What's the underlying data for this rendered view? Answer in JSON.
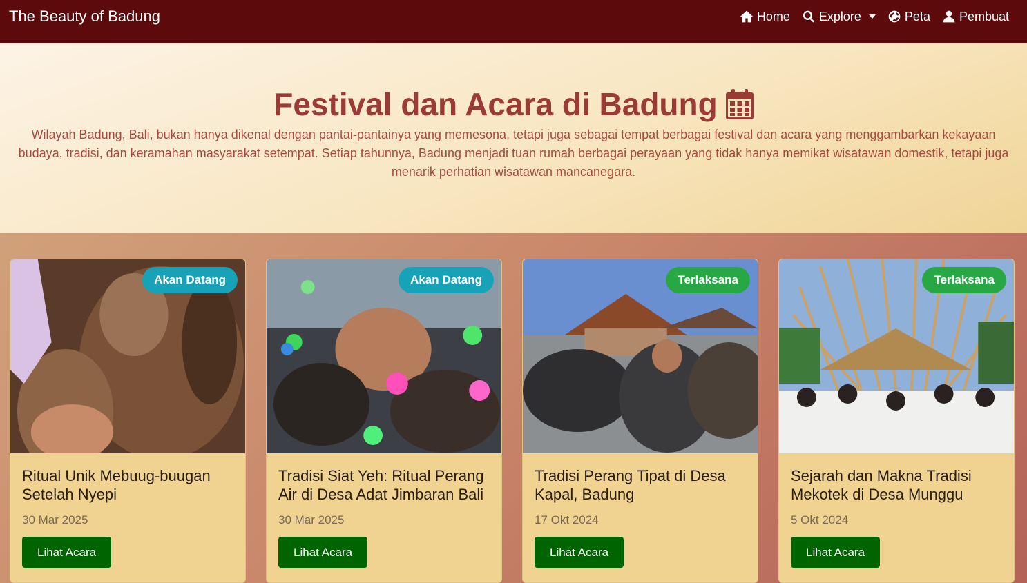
{
  "navbar": {
    "brand": "The Beauty of Badung",
    "links": [
      {
        "label": "Home",
        "icon": "home-icon"
      },
      {
        "label": "Explore",
        "icon": "search-icon"
      },
      {
        "label": "Peta",
        "icon": "globe-icon"
      },
      {
        "label": "Pembuat",
        "icon": "user-icon"
      }
    ]
  },
  "hero": {
    "title": "Festival dan Acara di Badung",
    "icon": "calendar-icon",
    "description": "Wilayah Badung, Bali, bukan hanya dikenal dengan pantai-pantainya yang memesona, tetapi juga sebagai tempat berbagai festival dan acara yang menggambarkan kekayaan budaya, tradisi, dan keramahan masyarakat setempat. Setiap tahunnya, Badung menjadi tuan rumah berbagai perayaan yang tidak hanya memikat wisatawan domestik, tetapi juga menarik perhatian wisatawan mancanegara."
  },
  "events": [
    {
      "title": "Ritual Unik Mebuug-buugan Setelah Nyepi",
      "date": "30 Mar 2025",
      "status": "Akan Datang",
      "button": "Lihat Acara"
    },
    {
      "title": "Tradisi Siat Yeh: Ritual Perang Air di Desa Adat Jimbaran Bali",
      "date": "30 Mar 2025",
      "status": "Akan Datang",
      "button": "Lihat Acara"
    },
    {
      "title": "Tradisi Perang Tipat di Desa Kapal, Badung",
      "date": "17 Okt 2024",
      "status": "Terlaksana",
      "button": "Lihat Acara"
    },
    {
      "title": "Sejarah dan Makna Tradisi Mekotek di Desa Munggu",
      "date": "5 Okt 2024",
      "status": "Terlaksana",
      "button": "Lihat Acara"
    }
  ],
  "colors": {
    "navbar": "#5c0a0c",
    "title": "#9b3b36",
    "badge_upcoming": "#17a2b8",
    "badge_done": "#28a745",
    "button": "#006400",
    "card": "#f0d390"
  }
}
